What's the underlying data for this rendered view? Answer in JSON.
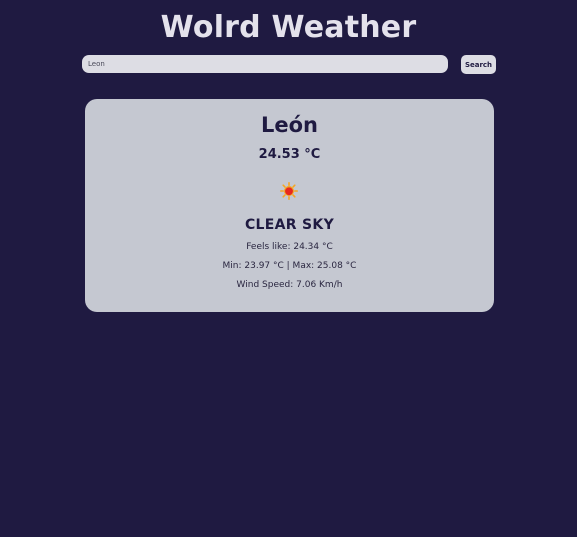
{
  "app": {
    "title": "Wolrd Weather"
  },
  "search": {
    "value": "Leon",
    "button_label": "Search"
  },
  "weather": {
    "city": "León",
    "temperature": "24.53 °C",
    "icon": "sun-icon",
    "description": "CLEAR SKY",
    "feels_like": "Feels like: 24.34 °C",
    "min_max": "Min: 23.97 °C | Max: 25.08 °C",
    "wind_speed": "Wind Speed: 7.06 Km/h"
  },
  "colors": {
    "background": "#1f1a41",
    "card": "#c5c8d1",
    "input": "#dddde4",
    "text_dark": "#1f1a41",
    "title_text": "#e4e2ec",
    "sun_core": "#e8281e",
    "sun_rays": "#f5a623"
  }
}
